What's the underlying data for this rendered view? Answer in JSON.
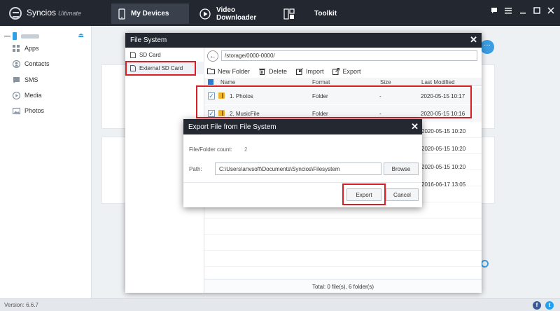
{
  "app": {
    "name": "Syncios",
    "edition": "Ultimate",
    "tabs": [
      {
        "label": "My Devices",
        "active": true
      },
      {
        "label": "Video Downloader",
        "active": false
      },
      {
        "label": "Toolkit",
        "active": false
      }
    ],
    "window_controls": [
      "chat-icon",
      "menu-icon",
      "minimize-icon",
      "maximize-icon",
      "close-icon"
    ]
  },
  "sidebar": {
    "device_name": "",
    "items": [
      {
        "label": "Apps",
        "icon": "apps-icon"
      },
      {
        "label": "Contacts",
        "icon": "contacts-icon"
      },
      {
        "label": "SMS",
        "icon": "sms-icon"
      },
      {
        "label": "Media",
        "icon": "media-icon"
      },
      {
        "label": "Photos",
        "icon": "photos-icon"
      }
    ]
  },
  "status": {
    "version": "Version: 6.6.7"
  },
  "file_system": {
    "title": "File System",
    "locations": [
      {
        "label": "SD Card",
        "selected": false
      },
      {
        "label": "External SD Card",
        "selected": true
      }
    ],
    "path": "/storage/0000-0000/",
    "toolbar": {
      "new_folder": "New Folder",
      "delete": "Delete",
      "import": "Import",
      "export": "Export"
    },
    "columns": {
      "name": "Name",
      "format": "Format",
      "size": "Size",
      "modified": "Last Modified"
    },
    "rows": [
      {
        "name": "1. Photos",
        "format": "Folder",
        "size": "-",
        "modified": "2020-05-15 10:17",
        "checked": true
      },
      {
        "name": "2. MusicFile",
        "format": "Folder",
        "size": "-",
        "modified": "2020-05-15 10:16",
        "checked": true
      }
    ],
    "partial_dates": [
      "2020-05-15 10:20",
      "2020-05-15 10:20",
      "2020-05-15 10:20",
      "2016-06-17 13:05"
    ],
    "footer": "Total: 0 file(s), 6 folder(s)"
  },
  "export_dialog": {
    "title": "Export File from File System",
    "count_label": "File/Folder count:",
    "count_value": "2",
    "path_label": "Path:",
    "path_value": "C:\\Users\\anvsoft\\Documents\\Syncios\\Filesystem",
    "browse": "Browse",
    "export": "Export",
    "cancel": "Cancel"
  },
  "colors": {
    "titlebar": "#222730",
    "accent": "#2ea0e6",
    "highlight": "#d91f26"
  }
}
